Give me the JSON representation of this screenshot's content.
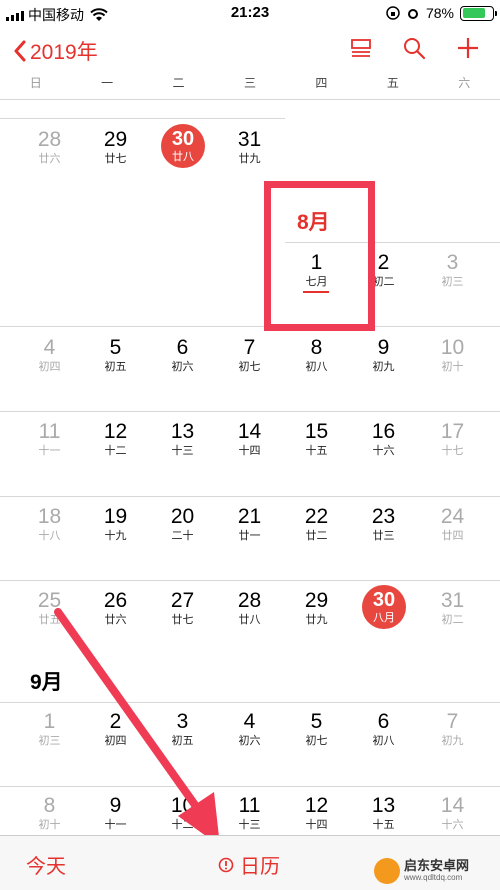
{
  "status": {
    "carrier": "中国移动",
    "time": "21:23",
    "battery": "78%",
    "battery_level": 0.78
  },
  "nav": {
    "back_label": "2019年"
  },
  "weekdays": [
    "日",
    "一",
    "二",
    "三",
    "四",
    "五",
    "六"
  ],
  "august": {
    "label": "8月",
    "rows": [
      [
        [
          "28",
          "廿六",
          true
        ],
        [
          "29",
          "廿七",
          false
        ],
        [
          "30",
          "廿八",
          false
        ],
        [
          "31",
          "廿九",
          false
        ]
      ],
      [
        [
          "1",
          "七月",
          false
        ],
        [
          "2",
          "初二",
          false
        ],
        [
          "3",
          "初三",
          true
        ]
      ],
      [
        [
          "4",
          "初四",
          true
        ],
        [
          "5",
          "初五",
          false
        ],
        [
          "6",
          "初六",
          false
        ],
        [
          "7",
          "初七",
          false
        ],
        [
          "8",
          "初八",
          false
        ],
        [
          "9",
          "初九",
          false
        ],
        [
          "10",
          "初十",
          true
        ]
      ],
      [
        [
          "11",
          "十一",
          true
        ],
        [
          "12",
          "十二",
          false
        ],
        [
          "13",
          "十三",
          false
        ],
        [
          "14",
          "十四",
          false
        ],
        [
          "15",
          "十五",
          false
        ],
        [
          "16",
          "十六",
          false
        ],
        [
          "17",
          "十七",
          true
        ]
      ],
      [
        [
          "18",
          "十八",
          true
        ],
        [
          "19",
          "十九",
          false
        ],
        [
          "20",
          "二十",
          false
        ],
        [
          "21",
          "廿一",
          false
        ],
        [
          "22",
          "廿二",
          false
        ],
        [
          "23",
          "廿三",
          false
        ],
        [
          "24",
          "廿四",
          true
        ]
      ],
      [
        [
          "25",
          "廿五",
          true
        ],
        [
          "26",
          "廿六",
          false
        ],
        [
          "27",
          "廿七",
          false
        ],
        [
          "28",
          "廿八",
          false
        ],
        [
          "29",
          "廿九",
          false
        ],
        [
          "30",
          "八月",
          false
        ],
        [
          "31",
          "初二",
          true
        ]
      ]
    ]
  },
  "september": {
    "label": "9月",
    "rows": [
      [
        [
          "1",
          "初三",
          true
        ],
        [
          "2",
          "初四",
          false
        ],
        [
          "3",
          "初五",
          false
        ],
        [
          "4",
          "初六",
          false
        ],
        [
          "5",
          "初七",
          false
        ],
        [
          "6",
          "初八",
          false
        ],
        [
          "7",
          "初九",
          true
        ]
      ],
      [
        [
          "8",
          "初十",
          true
        ],
        [
          "9",
          "十一",
          false
        ],
        [
          "10",
          "十二",
          false
        ],
        [
          "11",
          "十三",
          false
        ],
        [
          "12",
          "十四",
          false
        ],
        [
          "13",
          "十五",
          false
        ],
        [
          "14",
          "十六",
          true
        ]
      ]
    ]
  },
  "tabbar": {
    "today": "今天",
    "calendars": "日历"
  },
  "watermark": {
    "name": "启东安卓网",
    "url": "www.qdltdq.com"
  },
  "colors": {
    "accent": "#e5322d",
    "highlight_box": "#ef3b53",
    "today_circle": "#e8473f"
  }
}
